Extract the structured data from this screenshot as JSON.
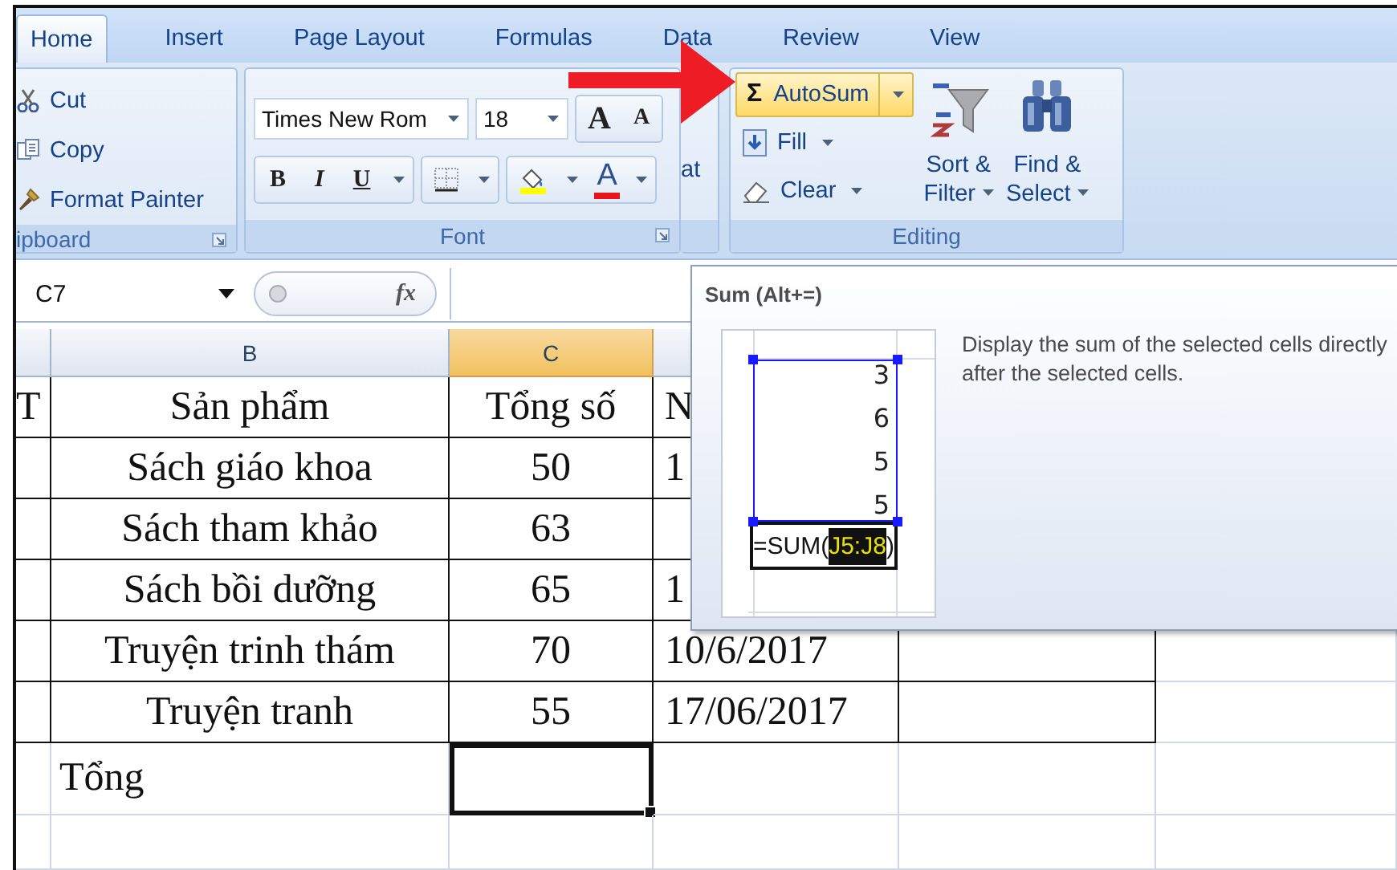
{
  "tabs": [
    {
      "label": "Home",
      "selected": true
    },
    {
      "label": "Insert",
      "selected": false
    },
    {
      "label": "Page Layout",
      "selected": false
    },
    {
      "label": "Formulas",
      "selected": false
    },
    {
      "label": "Data",
      "selected": false
    },
    {
      "label": "Review",
      "selected": false
    },
    {
      "label": "View",
      "selected": false
    }
  ],
  "ribbon": {
    "clipboard": {
      "label": "ipboard",
      "items": [
        {
          "label": "Cut",
          "kind": "cut"
        },
        {
          "label": "Copy",
          "kind": "copy"
        },
        {
          "label": "Format Painter",
          "kind": "painter"
        }
      ]
    },
    "font": {
      "label": "Font",
      "font_name": "Times New Rom",
      "font_size": "18",
      "grow": "A",
      "shrink": "A",
      "styles": [
        {
          "label": "B",
          "kind": "bold"
        },
        {
          "label": "I",
          "kind": "italic"
        },
        {
          "label": "U",
          "kind": "underline"
        }
      ],
      "font_color": "A"
    },
    "cut_group_text": "at",
    "editing": {
      "label": "Editing",
      "autosum": {
        "symbol": "Σ",
        "label": "AutoSum",
        "highlighted": true
      },
      "fill": "Fill",
      "clear": "Clear",
      "sort": [
        "Sort &",
        "Filter"
      ],
      "find": [
        "Find &",
        "Select"
      ]
    }
  },
  "formula_bar": {
    "name_box": "C7",
    "fx": "fx"
  },
  "sheet": {
    "columns": [
      {
        "selected": false
      },
      {
        "label": "B",
        "selected": false
      },
      {
        "label": "C",
        "selected": true
      },
      {
        "selected": false
      }
    ],
    "rows": [
      {
        "kind": "table",
        "cells": [
          {
            "text": "T",
            "selected": false
          },
          {
            "text": "Sản phẩm",
            "selected": false
          },
          {
            "text": "Tổng số",
            "selected": false
          },
          {
            "text": "N",
            "selected": false
          }
        ]
      },
      {
        "kind": "table",
        "cells": [
          {
            "selected": false
          },
          {
            "text": "Sách giáo khoa",
            "selected": false
          },
          {
            "text": "50",
            "selected": false
          },
          {
            "text": "1",
            "selected": false
          }
        ]
      },
      {
        "kind": "table",
        "cells": [
          {
            "selected": false
          },
          {
            "text": "Sách tham khảo",
            "selected": false
          },
          {
            "text": "63",
            "selected": false
          },
          {
            "selected": false
          }
        ]
      },
      {
        "kind": "table",
        "cells": [
          {
            "selected": false
          },
          {
            "text": "Sách bồi dưỡng",
            "selected": false
          },
          {
            "text": "65",
            "selected": false
          },
          {
            "text": "1",
            "selected": false
          }
        ]
      },
      {
        "kind": "table",
        "cells": [
          {
            "selected": false
          },
          {
            "text": "Truyện trinh thám",
            "selected": false
          },
          {
            "text": "70",
            "selected": false
          },
          {
            "text": "10/6/2017",
            "selected": false
          },
          {
            "selected": false
          }
        ]
      },
      {
        "kind": "table",
        "cells": [
          {
            "selected": false
          },
          {
            "text": "Truyện tranh",
            "selected": false
          },
          {
            "text": "55",
            "selected": false
          },
          {
            "text": "17/06/2017",
            "selected": false
          },
          {
            "selected": false
          }
        ]
      },
      {
        "kind": "total",
        "cells": [
          {
            "selected": false
          },
          {
            "text": "Tổng",
            "selected": false
          },
          {
            "selected": true
          },
          {
            "selected": false
          },
          {
            "selected": false
          }
        ]
      },
      {
        "kind": "plain",
        "cells": [
          {
            "selected": false
          },
          {
            "selected": false
          },
          {
            "selected": false
          },
          {
            "selected": false
          },
          {
            "selected": false
          }
        ]
      }
    ]
  },
  "tooltip": {
    "title": "Sum (Alt+=)",
    "preview": {
      "values": [
        "3",
        "6",
        "5",
        "5"
      ],
      "formula_start": "=SUM(",
      "formula_range": "J5:J8",
      "formula_end": ")"
    },
    "description": "Display the sum of the selected cells directly after the selected cells."
  }
}
